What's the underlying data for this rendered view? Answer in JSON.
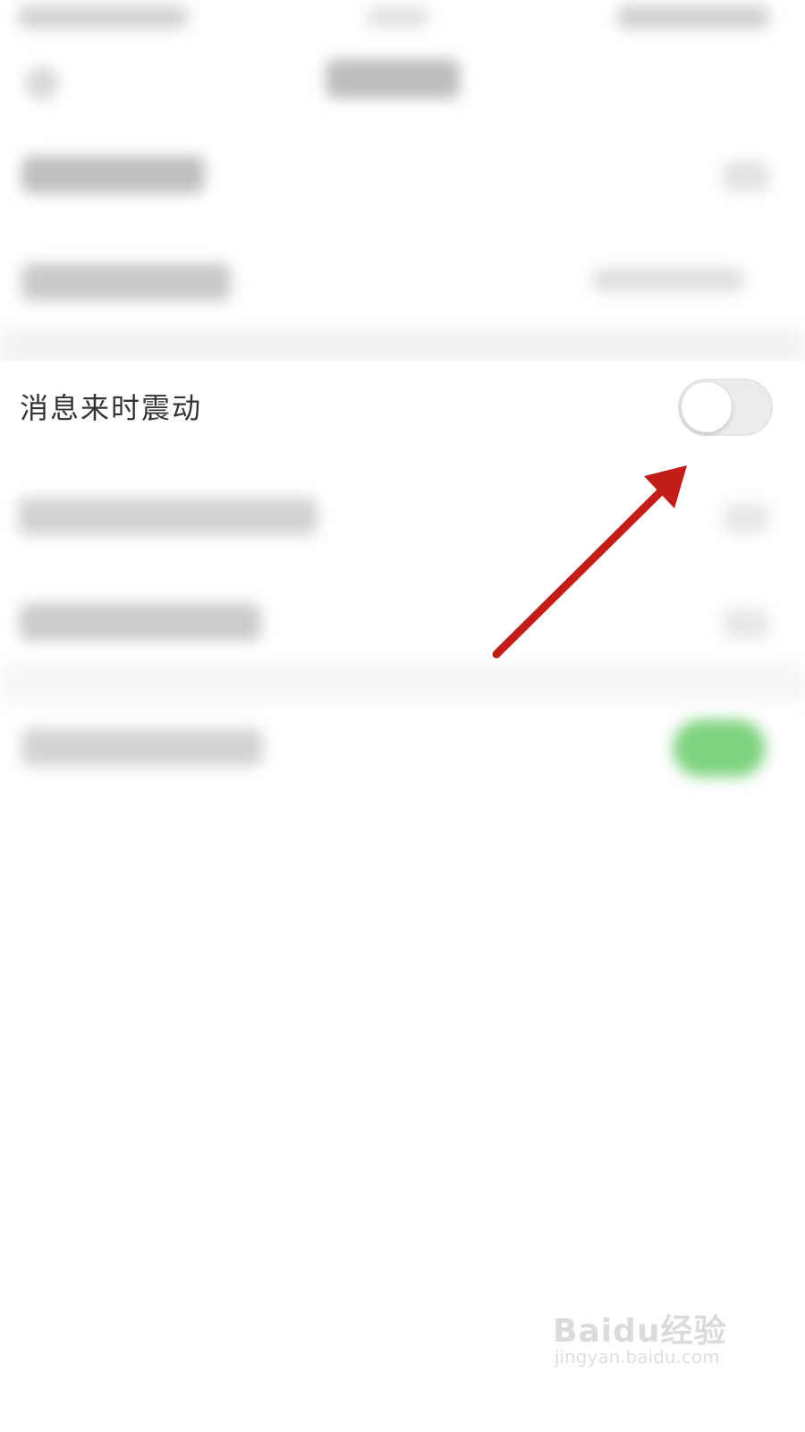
{
  "setting": {
    "label": "消息来时震动",
    "toggle_state": "off"
  },
  "annotation": {
    "arrow_color": "#c41c16"
  },
  "watermark": {
    "brand": "Baidu经验",
    "url": "jingyan.baidu.com"
  },
  "colors": {
    "toggle_off": "#ececec",
    "toggle_on_blurred": "#7ed37e"
  }
}
